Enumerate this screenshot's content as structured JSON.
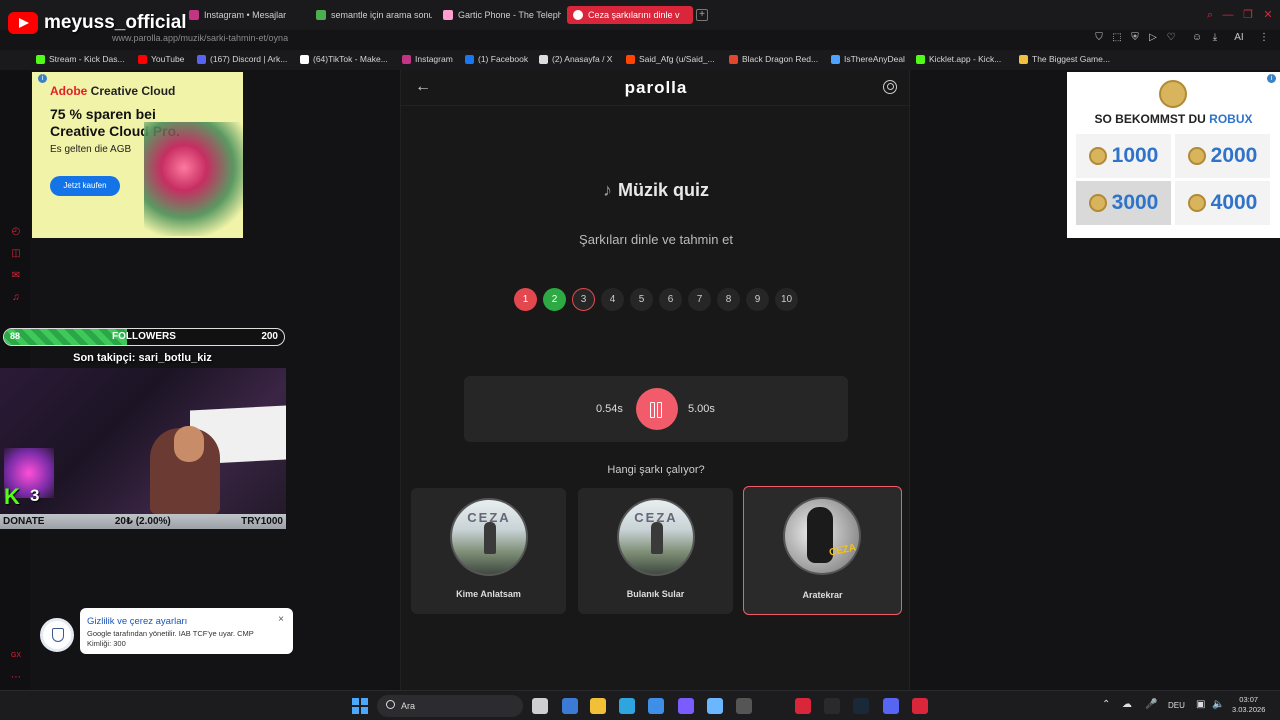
{
  "stream": {
    "channel_name": "meyuss_official"
  },
  "browser": {
    "tabs": [
      {
        "label": "Instagram • Mesajlar",
        "color": "#c13584"
      },
      {
        "label": "semantle için arama sonuç",
        "color": "#4caf50"
      },
      {
        "label": "Gartic Phone - The Teleph",
        "color": "#ff9ecf"
      },
      {
        "label": "Ceza şarkılarını dinle v",
        "color": "#ffffff"
      }
    ],
    "new_tab": "+",
    "address": "www.parolla.app/muzik/sarki-tahmin-et/oyna",
    "bookmarks": [
      {
        "label": "Stream - Kick Das...",
        "color": "#53fc18"
      },
      {
        "label": "YouTube",
        "color": "#ff0000"
      },
      {
        "label": "(167) Discord | Ark...",
        "color": "#5865f2"
      },
      {
        "label": "(64)TikTok - Make...",
        "color": "#ffffff"
      },
      {
        "label": "Instagram",
        "color": "#c13584"
      },
      {
        "label": "(1) Facebook",
        "color": "#1877f2"
      },
      {
        "label": "(2) Anasayfa / X",
        "color": "#dddddd"
      },
      {
        "label": "Said_Afg (u/Said_...",
        "color": "#ff4500"
      },
      {
        "label": "Black Dragon Red...",
        "color": "#e2462d"
      },
      {
        "label": "IsThereAnyDeal",
        "color": "#4da3ff"
      },
      {
        "label": "Kicklet.app - Kick...",
        "color": "#53fc18"
      },
      {
        "label": "The Biggest Game...",
        "color": "#f0c040"
      }
    ],
    "tool_icons": [
      "extension-icon",
      "screenshot-icon",
      "shield-icon",
      "play-icon",
      "history-icon",
      "heart-icon",
      "profile-icon",
      "download-icon",
      "ai-icon",
      "menu-icon"
    ],
    "ai_label": "AI"
  },
  "page": {
    "brand": "parolla",
    "title": "Müzik quiz",
    "subtitle": "Şarkıları dinle ve tahmin et",
    "steps": [
      {
        "label": "1",
        "state": "wrong"
      },
      {
        "label": "2",
        "state": "right"
      },
      {
        "label": "3",
        "state": "current"
      },
      {
        "label": "4",
        "state": "upcoming"
      },
      {
        "label": "5",
        "state": "upcoming"
      },
      {
        "label": "6",
        "state": "upcoming"
      },
      {
        "label": "7",
        "state": "upcoming"
      },
      {
        "label": "8",
        "state": "upcoming"
      },
      {
        "label": "9",
        "state": "upcoming"
      },
      {
        "label": "10",
        "state": "upcoming"
      }
    ],
    "player": {
      "current_time": "0.54s",
      "total_time": "5.00s",
      "state": "playing"
    },
    "question": "Hangi şarkı çalıyor?",
    "options": [
      {
        "label": "Kime Anlatsam",
        "cover": "album-cover",
        "cover_text": "CEZA",
        "selected": false
      },
      {
        "label": "Bulanık Sular",
        "cover": "album-cover",
        "cover_text": "CEZA",
        "selected": false
      },
      {
        "label": "Aratekrar",
        "cover": "portrait-cover",
        "cover_text": "CEZA",
        "selected": true
      }
    ],
    "accent_color": "#f15b6a"
  },
  "ads": {
    "left": {
      "brand_prefix": "Adobe",
      "brand_suffix": " Creative Cloud",
      "headline": "75 % sparen bei Creative Cloud Pro.",
      "small": "Es gelten die AGB",
      "cta": "Jetzt kaufen"
    },
    "right": {
      "title_prefix": "SO BEKOMMST DU ",
      "title_highlight": "ROBUX",
      "amounts": [
        "1000",
        "2000",
        "3000",
        "4000"
      ],
      "highlighted": "3000"
    }
  },
  "overlay": {
    "followers": {
      "start": "88",
      "label": "FOLLOWERS",
      "goal": "200",
      "progress": 0.44
    },
    "last_follower": "Son takipçi: sari_botlu_kiz",
    "kick_logo": "K",
    "kick_viewers": "3",
    "donate": {
      "label": "DONATE",
      "amount": "20₺ (2.00%)",
      "goal": "TRY1000"
    }
  },
  "consent": {
    "title": "Gizlilik ve çerez ayarları",
    "text": "Google tarafından yönetilir. IAB TCF'ye uyar. CMP Kimliği: 300",
    "close": "×"
  },
  "taskbar": {
    "search_placeholder": "Ara",
    "language": "DEU",
    "time": "03:07",
    "date": "3.03.2026",
    "apps": [
      {
        "name": "task-view-icon",
        "color": "#cfcfcf"
      },
      {
        "name": "widgets-icon",
        "color": "#3b7bd6"
      },
      {
        "name": "file-explorer-icon",
        "color": "#f2c037"
      },
      {
        "name": "edge-icon",
        "color": "#2fa5e0"
      },
      {
        "name": "store-icon",
        "color": "#3f8ee8"
      },
      {
        "name": "apps-icon",
        "color": "#7a5cff"
      },
      {
        "name": "chrome-icon",
        "color": "#6bb7ff"
      },
      {
        "name": "obs-icon",
        "color": "#555555"
      },
      {
        "name": "app-red-icon",
        "color": "#d9263a"
      },
      {
        "name": "epic-games-icon",
        "color": "#2a2a2a"
      },
      {
        "name": "steam-icon",
        "color": "#1b2838"
      },
      {
        "name": "discord-icon",
        "color": "#5865f2"
      },
      {
        "name": "opera-gx-icon",
        "color": "#d9263a"
      }
    ]
  }
}
